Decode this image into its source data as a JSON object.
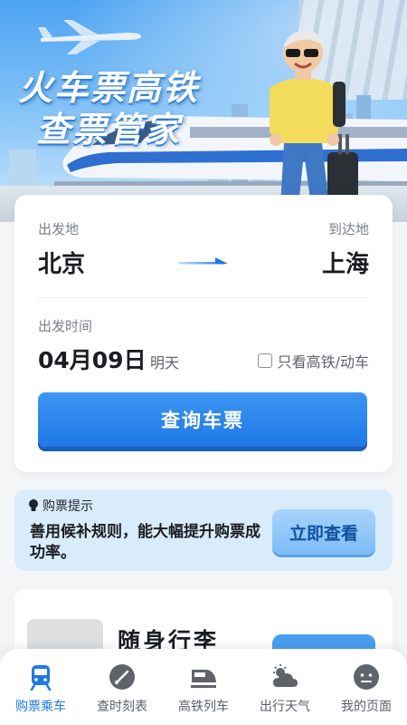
{
  "banner": {
    "title_line1": "火车票高铁",
    "title_line2": "查票管家"
  },
  "search": {
    "from_label": "出发地",
    "to_label": "到达地",
    "from_city": "北京",
    "to_city": "上海",
    "date_label": "出发时间",
    "date_value": "04月09日",
    "date_relative": "明天",
    "high_speed_only_label": "只看高铁/动车",
    "high_speed_only_checked": false,
    "search_button": "查询车票"
  },
  "tip": {
    "title": "购票提示",
    "body": "善用候补规则，能大幅提升购票成功率。",
    "button": "立即查看"
  },
  "luggage": {
    "title": "随身行李"
  },
  "nav": {
    "items": [
      {
        "label": "购票乘车",
        "icon": "train-ticket-icon",
        "active": true
      },
      {
        "label": "查时刻表",
        "icon": "timetable-icon",
        "active": false
      },
      {
        "label": "高铁列车",
        "icon": "high-speed-train-icon",
        "active": false
      },
      {
        "label": "出行天气",
        "icon": "weather-icon",
        "active": false
      },
      {
        "label": "我的页面",
        "icon": "profile-icon",
        "active": false
      }
    ]
  },
  "colors": {
    "accent": "#1f78e6",
    "tip_background": "#d9ecfc",
    "page_background": "#f4f5f7"
  }
}
